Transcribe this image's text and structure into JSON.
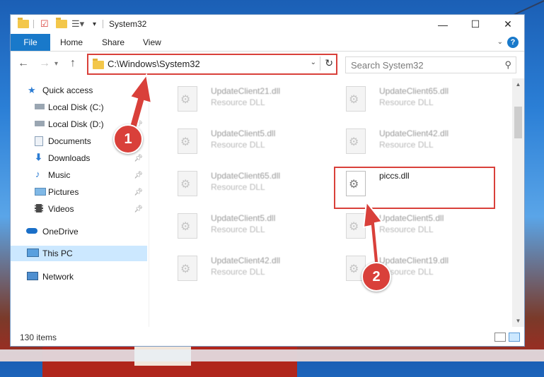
{
  "window": {
    "title": "System32",
    "controls": {
      "minimize": "—",
      "maximize": "☐",
      "close": "✕"
    }
  },
  "ribbon": {
    "tabs": [
      {
        "label": "File"
      },
      {
        "label": "Home"
      },
      {
        "label": "Share"
      },
      {
        "label": "View"
      }
    ],
    "help": "?"
  },
  "navbar": {
    "address": "C:\\Windows\\System32",
    "search_placeholder": "Search System32"
  },
  "sidebar": {
    "items": [
      {
        "label": "Quick access",
        "icon": "star-icon",
        "pinned": false
      },
      {
        "label": "Local Disk (C:)",
        "icon": "drive-icon",
        "pinned": true
      },
      {
        "label": "Local Disk (D:)",
        "icon": "drive-icon",
        "pinned": true
      },
      {
        "label": "Documents",
        "icon": "documents-icon",
        "pinned": true
      },
      {
        "label": "Downloads",
        "icon": "download-icon",
        "pinned": true
      },
      {
        "label": "Music",
        "icon": "music-icon",
        "pinned": true
      },
      {
        "label": "Pictures",
        "icon": "pictures-icon",
        "pinned": true
      },
      {
        "label": "Videos",
        "icon": "videos-icon",
        "pinned": true
      },
      {
        "label": "OneDrive",
        "icon": "cloud-icon",
        "pinned": false
      },
      {
        "label": "This PC",
        "icon": "computer-icon",
        "pinned": false,
        "selected": true
      },
      {
        "label": "Network",
        "icon": "network-icon",
        "pinned": false
      }
    ]
  },
  "files": [
    {
      "name": "UpdateClient21.dll",
      "type": "Resource DLL"
    },
    {
      "name": "UpdateClient65.dll",
      "type": "Resource DLL"
    },
    {
      "name": "UpdateClient5.dll",
      "type": "Resource DLL"
    },
    {
      "name": "UpdateClient42.dll",
      "type": "Resource DLL"
    },
    {
      "name": "UpdateClient65.dll",
      "type": "Resource DLL"
    },
    {
      "name": "piccs.dll",
      "type": ""
    },
    {
      "name": "UpdateClient5.dll",
      "type": "Resource DLL"
    },
    {
      "name": "UpdateClient5.dll",
      "type": "Resource DLL"
    },
    {
      "name": "UpdateClient42.dll",
      "type": "Resource DLL"
    },
    {
      "name": "UpdateClient19.dll",
      "type": "Resource DLL"
    }
  ],
  "status": {
    "item_count": "130 items"
  },
  "annotations": {
    "step1": "1",
    "step2": "2"
  },
  "colors": {
    "accent": "#1979ca",
    "highlight": "#d9403a",
    "selected": "#cce8ff"
  }
}
